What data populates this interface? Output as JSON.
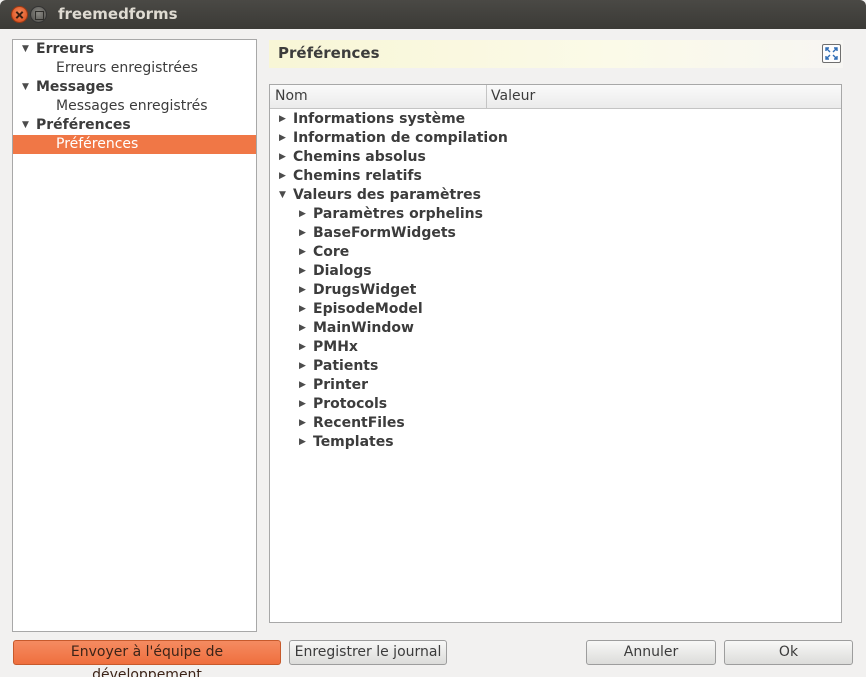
{
  "window": {
    "title": "freemedforms"
  },
  "sidebar": {
    "items": [
      {
        "label": "Erreurs",
        "level": 0,
        "expanded": true
      },
      {
        "label": "Erreurs enregistrées",
        "level": 1
      },
      {
        "label": "Messages",
        "level": 0,
        "expanded": true
      },
      {
        "label": "Messages enregistrés",
        "level": 1
      },
      {
        "label": "Préférences",
        "level": 0,
        "expanded": true
      },
      {
        "label": "Préférences",
        "level": 1,
        "selected": true
      }
    ]
  },
  "main": {
    "header_title": "Préférences",
    "columns": {
      "name": "Nom",
      "value": "Valeur"
    },
    "tree": [
      {
        "label": "Informations système",
        "level": 0,
        "expanded": false
      },
      {
        "label": "Information de compilation",
        "level": 0,
        "expanded": false
      },
      {
        "label": "Chemins absolus",
        "level": 0,
        "expanded": false
      },
      {
        "label": "Chemins relatifs",
        "level": 0,
        "expanded": false
      },
      {
        "label": "Valeurs des paramètres",
        "level": 0,
        "expanded": true
      },
      {
        "label": "Paramètres orphelins",
        "level": 1,
        "expanded": false
      },
      {
        "label": "BaseFormWidgets",
        "level": 1,
        "expanded": false
      },
      {
        "label": "Core",
        "level": 1,
        "expanded": false
      },
      {
        "label": "Dialogs",
        "level": 1,
        "expanded": false
      },
      {
        "label": "DrugsWidget",
        "level": 1,
        "expanded": false
      },
      {
        "label": "EpisodeModel",
        "level": 1,
        "expanded": false
      },
      {
        "label": "MainWindow",
        "level": 1,
        "expanded": false
      },
      {
        "label": "PMHx",
        "level": 1,
        "expanded": false
      },
      {
        "label": "Patients",
        "level": 1,
        "expanded": false
      },
      {
        "label": "Printer",
        "level": 1,
        "expanded": false
      },
      {
        "label": "Protocols",
        "level": 1,
        "expanded": false
      },
      {
        "label": "RecentFiles",
        "level": 1,
        "expanded": false
      },
      {
        "label": "Templates",
        "level": 1,
        "expanded": false
      }
    ]
  },
  "buttons": {
    "send": "Envoyer à l'équipe de développement",
    "save_log": "Enregistrer le journal",
    "cancel": "Annuler",
    "ok": "Ok"
  },
  "colors": {
    "accent": "#f07746",
    "header_bg": "#f8f6d6"
  },
  "icons": {
    "fullscreen": "fullscreen-icon",
    "expanded": "triangle-down",
    "collapsed": "triangle-right"
  }
}
